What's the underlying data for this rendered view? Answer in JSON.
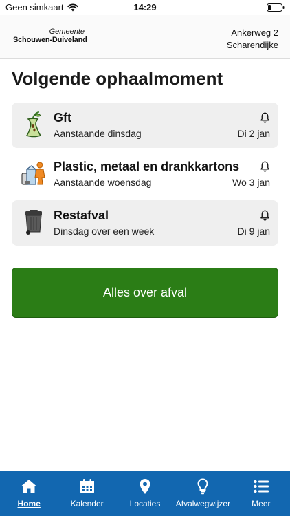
{
  "status": {
    "carrier": "Geen simkaart",
    "time": "14:29"
  },
  "header": {
    "logo_top": "Gemeente",
    "logo_bottom": "Schouwen-Duiveland",
    "address_line1": "Ankerweg 2",
    "address_line2": "Scharendijke"
  },
  "main": {
    "title": "Volgende ophaalmoment",
    "items": [
      {
        "name": "Gft",
        "subtitle": "Aanstaande dinsdag",
        "date": "Di 2 jan",
        "icon": "apple-core-icon",
        "bell": "bell-icon"
      },
      {
        "name": "Plastic, metaal en drankkartons",
        "subtitle": "Aanstaande woensdag",
        "date": "Wo 3 jan",
        "icon": "plastic-metal-icon",
        "bell": "bell-icon"
      },
      {
        "name": "Restafval",
        "subtitle": "Dinsdag over een week",
        "date": "Di 9 jan",
        "icon": "trash-bin-icon",
        "bell": "bell-icon"
      }
    ],
    "button_label": "Alles over afval"
  },
  "tabbar": {
    "tabs": [
      {
        "label": "Home",
        "icon": "home-icon",
        "active": true
      },
      {
        "label": "Kalender",
        "icon": "calendar-icon",
        "active": false
      },
      {
        "label": "Locaties",
        "icon": "location-pin-icon",
        "active": false
      },
      {
        "label": "Afvalwegwijzer",
        "icon": "lightbulb-icon",
        "active": false
      },
      {
        "label": "Meer",
        "icon": "list-icon",
        "active": false
      }
    ]
  },
  "colors": {
    "accent_green": "#2b7d16",
    "tabbar_blue": "#1267b0",
    "card_grey": "#efefef"
  }
}
